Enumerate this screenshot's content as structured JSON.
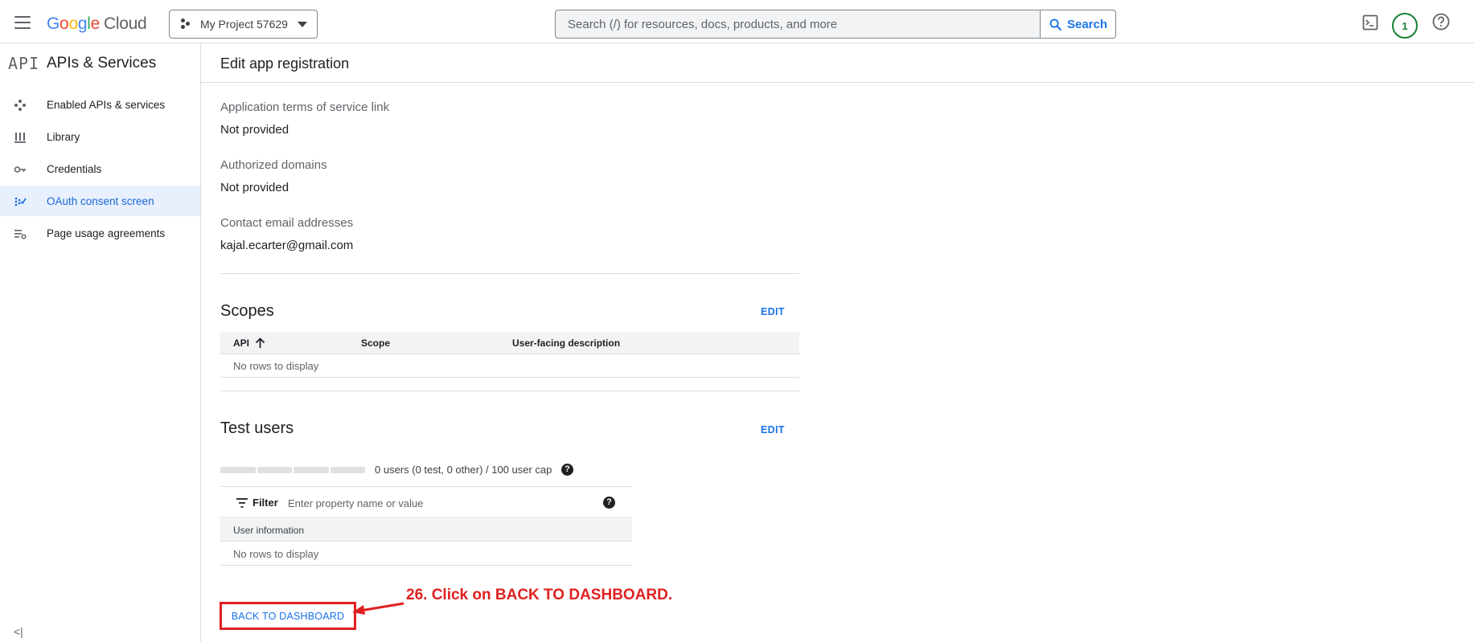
{
  "topbar": {
    "logo": {
      "g1": "G",
      "o1": "o",
      "o2": "o",
      "g2": "g",
      "l": "l",
      "e": "e",
      "cloud": "Cloud"
    },
    "project": "My Project 57629",
    "search_placeholder": "Search (/) for resources, docs, products, and more",
    "search_button": "Search",
    "avatar_initial": "1"
  },
  "sidebar": {
    "api_logo": "API",
    "title": "APIs & Services",
    "items": [
      {
        "label": "Enabled APIs & services"
      },
      {
        "label": "Library"
      },
      {
        "label": "Credentials"
      },
      {
        "label": "OAuth consent screen"
      },
      {
        "label": "Page usage agreements"
      }
    ],
    "collapse_glyph": "<|"
  },
  "main": {
    "title": "Edit app registration",
    "fields": [
      {
        "label": "Application terms of service link",
        "value": "Not provided"
      },
      {
        "label": "Authorized domains",
        "value": "Not provided"
      },
      {
        "label": "Contact email addresses",
        "value": "kajal.ecarter@gmail.com"
      }
    ],
    "scopes": {
      "title": "Scopes",
      "edit": "EDIT",
      "columns": [
        "API",
        "Scope",
        "User-facing description"
      ],
      "empty": "No rows to display"
    },
    "test_users": {
      "title": "Test users",
      "edit": "EDIT",
      "cap_text": "0 users (0 test, 0 other) / 100 user cap",
      "filter_label": "Filter",
      "filter_placeholder": "Enter property name or value",
      "column": "User information",
      "empty": "No rows to display"
    },
    "back_button": "BACK TO DASHBOARD"
  },
  "annotation": {
    "text": "26. Click on BACK TO DASHBOARD.",
    "color": "#e02020"
  },
  "colors": {
    "accent": "#1a73e8",
    "active_bg": "#e8f0fe",
    "active_text": "#1967d2",
    "avatar_ring": "#188038"
  }
}
